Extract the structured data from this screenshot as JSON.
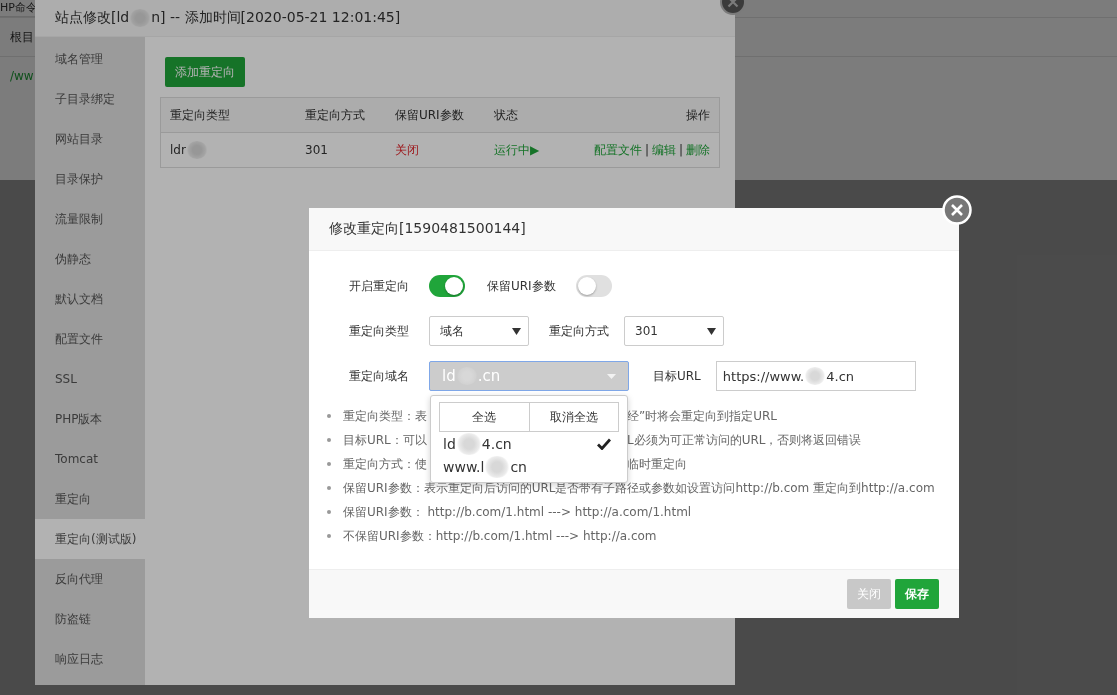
{
  "page": {
    "tab": "HP命令",
    "rows": [
      {
        "text": "根目",
        "kind": "plain"
      },
      {
        "text": "/ww",
        "kind": "path"
      }
    ]
  },
  "site_dialog": {
    "title_parts": [
      "站点修改[ld",
      "n] -- 添加时间[2020-05-21 12:01:45]"
    ],
    "sidebar": [
      {
        "label": "域名管理",
        "selected": false
      },
      {
        "label": "子目录绑定",
        "selected": false
      },
      {
        "label": "网站目录",
        "selected": false
      },
      {
        "label": "目录保护",
        "selected": false
      },
      {
        "label": "流量限制",
        "selected": false
      },
      {
        "label": "伪静态",
        "selected": false
      },
      {
        "label": "默认文档",
        "selected": false
      },
      {
        "label": "配置文件",
        "selected": false
      },
      {
        "label": "SSL",
        "selected": false
      },
      {
        "label": "PHP版本",
        "selected": false
      },
      {
        "label": "Tomcat",
        "selected": false
      },
      {
        "label": "重定向",
        "selected": false
      },
      {
        "label": "重定向(测试版)",
        "selected": true
      },
      {
        "label": "反向代理",
        "selected": false
      },
      {
        "label": "防盗链",
        "selected": false
      },
      {
        "label": "响应日志",
        "selected": false
      }
    ],
    "add_button": "添加重定向",
    "table": {
      "columns": [
        "重定向类型",
        "重定向方式",
        "保留URI参数",
        "状态",
        "操作"
      ],
      "rows": [
        {
          "type": "ldr",
          "blur_after": true,
          "method": "301",
          "keep_uri": {
            "text": "关闭",
            "on": false
          },
          "status": {
            "text": "运行中▶",
            "running": true
          },
          "actions": [
            "配置文件",
            "编辑",
            "删除"
          ],
          "separator": "|"
        }
      ]
    }
  },
  "redirect_dialog": {
    "title": "修改重定向[1590481500144]",
    "switches": [
      {
        "label": "开启重定向",
        "on": true
      },
      {
        "label": "保留URI参数",
        "on": false
      }
    ],
    "selects": [
      {
        "label": "重定向类型",
        "value": "域名"
      },
      {
        "label": "重定向方式",
        "value": "301"
      }
    ],
    "domain": {
      "label": "重定向域名",
      "parts": [
        "ld",
        ".cn"
      ],
      "expanded": true
    },
    "target": {
      "label": "目标URL",
      "parts": [
        "https://www.",
        "4.cn"
      ]
    },
    "dropdown": {
      "buttons": [
        "全选",
        "取消全选"
      ],
      "options": [
        {
          "parts": [
            "ld",
            "4.cn"
          ],
          "checked": true
        },
        {
          "parts": [
            "www.l",
            "cn"
          ],
          "checked": false
        }
      ]
    },
    "hints": [
      {
        "parts": [
          "重定向类型：表",
          "经”时将会重定向到指定URL"
        ]
      },
      {
        "parts": [
          "目标URL：可以",
          "L必须为可正常访问的URL，否则将返回错误"
        ]
      },
      {
        "parts": [
          "重定向方式：使",
          "临时重定向"
        ]
      },
      {
        "parts": [
          "保留URI参数：表示重定向后访问的URL是否带有子路径或参数如设置访问http://b.com 重定向到http://a.com"
        ]
      },
      {
        "parts": [
          "保留URI参数： http://b.com/1.html ---> http://a.com/1.html"
        ]
      },
      {
        "parts": [
          "不保留URI参数：http://b.com/1.html ---> http://a.com"
        ]
      }
    ],
    "buttons": [
      {
        "label": "关闭",
        "kind": "cancel"
      },
      {
        "label": "保存",
        "kind": "primary"
      }
    ]
  }
}
